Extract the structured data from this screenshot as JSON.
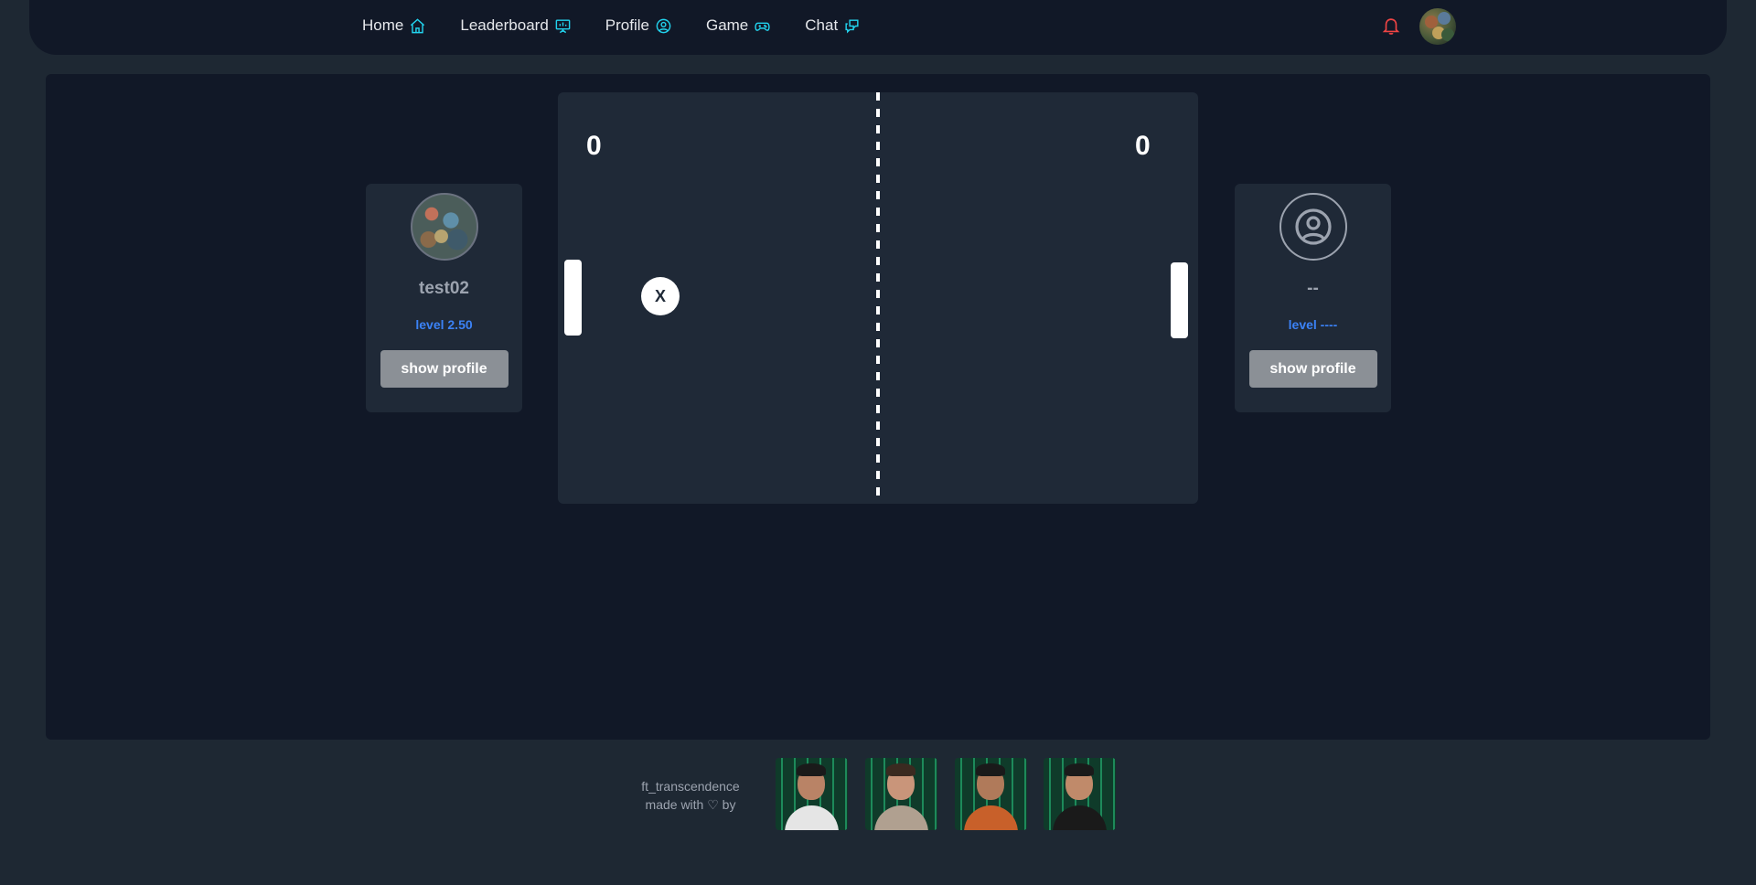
{
  "nav": {
    "items": [
      {
        "label": "Home",
        "icon": "home-icon"
      },
      {
        "label": "Leaderboard",
        "icon": "presentation-icon"
      },
      {
        "label": "Profile",
        "icon": "user-circle-icon"
      },
      {
        "label": "Game",
        "icon": "gamepad-icon"
      },
      {
        "label": "Chat",
        "icon": "chat-icon"
      }
    ],
    "notification_icon": "bell-icon",
    "accent_color": "#22d3ee",
    "bell_color": "#ef4444"
  },
  "players": {
    "left": {
      "name": "test02",
      "level": "level 2.50",
      "button": "show profile"
    },
    "right": {
      "name": "--",
      "level": "level ----",
      "button": "show profile"
    }
  },
  "game": {
    "score_left": "0",
    "score_right": "0",
    "ball_glyph": "X"
  },
  "footer": {
    "line1": "ft_transcendence",
    "line2": "made with ♡ by"
  }
}
